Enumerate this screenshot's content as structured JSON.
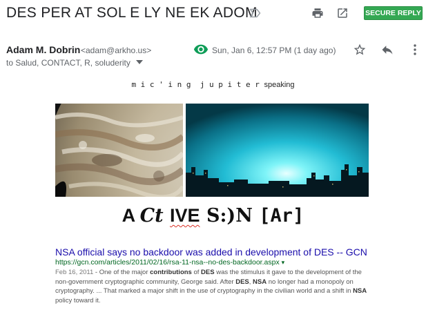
{
  "header": {
    "subject": "DES PER AT SOL E LY NE EK ADOM",
    "secure_reply": "SECURE REPLY",
    "icons": [
      "label-icon",
      "print-icon",
      "open-in-new-window-icon"
    ]
  },
  "message": {
    "sender_name": "Adam M. Dobrin",
    "sender_email": "<adam@arkho.us>",
    "recipients": "to Salud, CONTACT, R, soluderity",
    "date": "Sun, Jan 6, 12:57 PM (1 day ago)",
    "icons": [
      "eye-icon",
      "star-icon",
      "reply-icon",
      "more-vert-icon"
    ]
  },
  "body": {
    "speaking_head": "m i c ' i n g  j u p i t e r ",
    "speaking_tail": "speaking",
    "images": [
      "jupiter-clouds-image",
      "blue-glow-night-skyline-image"
    ],
    "sign": {
      "seg1": "A ",
      "seg2": "Ct ",
      "seg3": "IVE",
      "seg4": " S:)N ",
      "seg5": "[Ar]"
    },
    "result": {
      "title": "NSA official says no backdoor was added in development of DES -- GCN",
      "url": "https://gcn.com/articles/2011/02/16/rsa-11-nsa--no-des-backdoor.aspx",
      "snippet_date": "Feb 16, 2011",
      "snippet_1": " - One of the major ",
      "snippet_b1": "contributions",
      "snippet_2": " of ",
      "snippet_b2": "DES",
      "snippet_3": " was the stimulus it gave to the development of the non-government cryptographic community, George said. After ",
      "snippet_b3": "DES",
      "snippet_4": ", ",
      "snippet_b4": "NSA",
      "snippet_5": " no longer had a monopoly on cryptography. ... That marked a major shift in the use of cryptography in the civilian world and a shift in ",
      "snippet_b5": "NSA",
      "snippet_6": " policy toward it."
    }
  },
  "colors": {
    "secure_green": "#34a853",
    "link_blue": "#1a0dab",
    "url_green": "#006621",
    "eye_green": "#0f9d58"
  }
}
